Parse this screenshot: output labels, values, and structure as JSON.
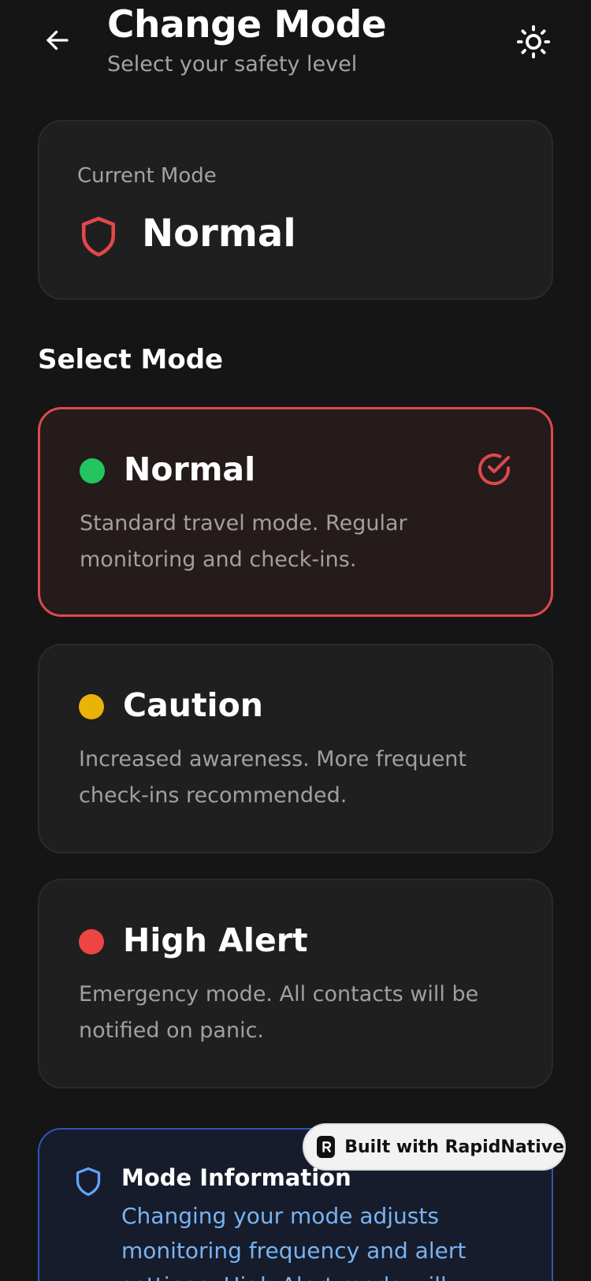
{
  "header": {
    "title": "Change Mode",
    "subtitle": "Select your safety level",
    "back_icon": "arrow-left-icon",
    "theme_icon": "sun-icon"
  },
  "current_mode": {
    "label": "Current Mode",
    "value": "Normal",
    "icon": "shield-icon",
    "icon_color": "#e0484a"
  },
  "select_section": {
    "title": "Select Mode"
  },
  "modes": [
    {
      "name": "Normal",
      "description": "Standard travel mode. Regular monitoring and check-ins.",
      "dot_color": "#22c55e",
      "selected": true
    },
    {
      "name": "Caution",
      "description": "Increased awareness. More frequent check-ins recommended.",
      "dot_color": "#eab308",
      "selected": false
    },
    {
      "name": "High Alert",
      "description": "Emergency mode. All contacts will be notified on panic.",
      "dot_color": "#ef4444",
      "selected": false
    }
  ],
  "info": {
    "title": "Mode Information",
    "text": "Changing your mode adjusts monitoring frequency and alert settings. High Alert mode will",
    "icon": "shield-icon",
    "accent_color": "#2f55b8"
  },
  "badge": {
    "label": "Built with RapidNative",
    "icon": "rapidnative-logo-icon"
  },
  "colors": {
    "background": "#151515",
    "card": "#1f1f1f",
    "selected_border": "#e0484a",
    "muted_text": "#a3a3a3"
  }
}
